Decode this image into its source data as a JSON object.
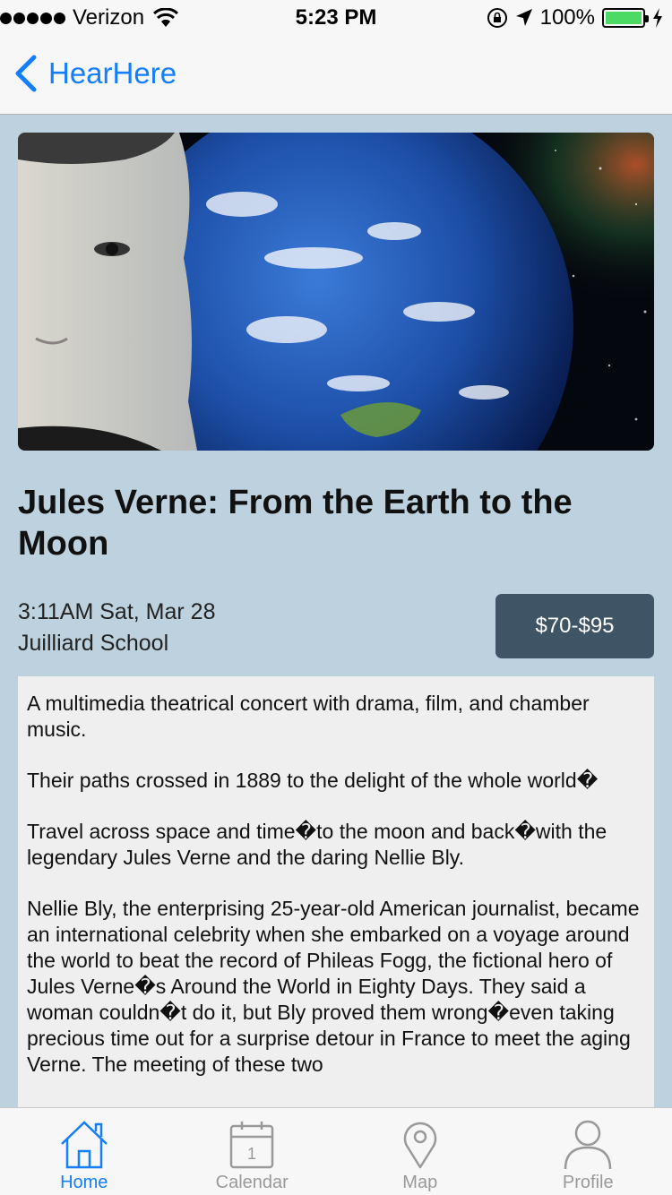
{
  "status_bar": {
    "carrier": "Verizon",
    "time": "5:23 PM",
    "battery": "100%"
  },
  "nav": {
    "back_label": "HearHere"
  },
  "event": {
    "title": "Jules Verne: From the Earth to the Moon",
    "datetime": "3:11AM Sat, Mar 28",
    "venue": "Juilliard School",
    "price": "$70-$95",
    "description": [
      "A multimedia theatrical concert with drama, film, and chamber music.",
      "Their paths crossed in 1889 to the delight of the whole world�",
      "Travel across space and time�to the moon and back�with the legendary Jules Verne and the daring Nellie Bly.",
      "Nellie Bly, the enterprising 25-year-old American journalist, became an international celebrity when she embarked on a voyage around the world to beat the record of Phileas Fogg, the fictional hero of Jules Verne�s Around the World in Eighty Days. They said a woman couldn�t do it, but Bly proved them wrong�even taking precious time out for a surprise detour in France to meet the aging Verne. The meeting of these two"
    ]
  },
  "tabs": [
    {
      "label": "Home",
      "icon": "home-icon",
      "active": true
    },
    {
      "label": "Calendar",
      "icon": "calendar-icon",
      "active": false,
      "badge": "1"
    },
    {
      "label": "Map",
      "icon": "map-pin-icon",
      "active": false
    },
    {
      "label": "Profile",
      "icon": "profile-icon",
      "active": false
    }
  ],
  "colors": {
    "accent": "#147efb",
    "background": "#bdd2de",
    "price_button": "#3f5565",
    "tab_inactive": "#999999"
  }
}
